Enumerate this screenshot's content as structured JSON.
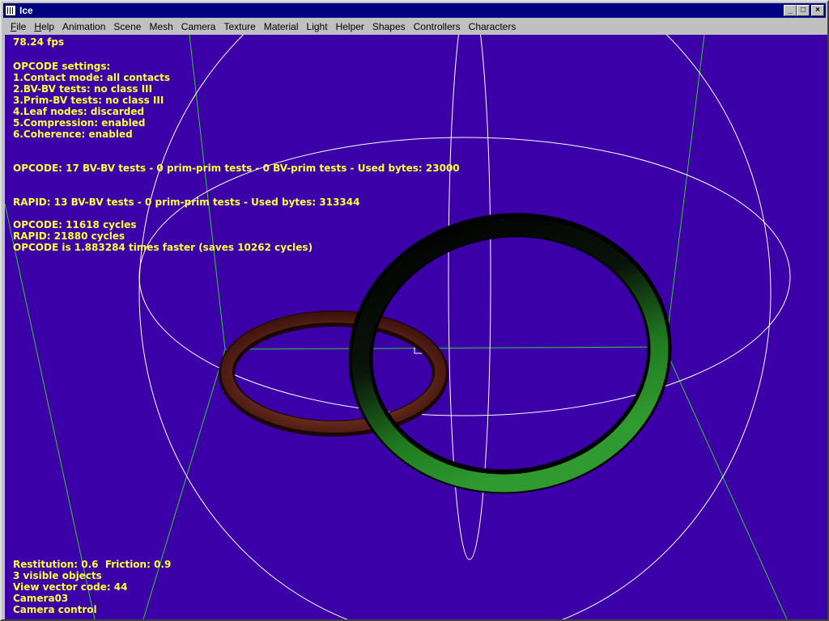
{
  "window": {
    "title": "Ice",
    "minimize_glyph": "_",
    "maximize_glyph": "□",
    "close_glyph": "×"
  },
  "menu": [
    "File",
    "Help",
    "Animation",
    "Scene",
    "Mesh",
    "Camera",
    "Texture",
    "Material",
    "Light",
    "Helper",
    "Shapes",
    "Controllers",
    "Characters"
  ],
  "hud": {
    "fps": "78.24 fps",
    "settings_title": "OPCODE settings:",
    "settings": [
      "1.Contact mode: all contacts",
      "2.BV-BV tests: no class III",
      "3.Prim-BV tests: no class III",
      "4.Leaf nodes: discarded",
      "5.Compression: enabled",
      "6.Coherence: enabled"
    ],
    "opcode_stats": "OPCODE: 17 BV-BV tests - 0 prim-prim tests - 0 BV-prim tests - Used bytes: 23000",
    "rapid_stats": "RAPID: 13 BV-BV tests - 0 prim-prim tests - Used bytes: 313344",
    "opcode_cycles": "OPCODE: 11618 cycles",
    "rapid_cycles": "RAPID: 21880 cycles",
    "comparison": "OPCODE is 1.883284 times faster (saves 10262 cycles)",
    "bottom": [
      "Restitution: 0.6  Friction: 0.9",
      "3 visible objects",
      "View vector code: 44",
      "Camera03",
      "Camera control"
    ]
  },
  "colors": {
    "viewport_bg": "#3b00a8",
    "hud_text": "#ffff3a",
    "titlebar": "#000080",
    "wire_white": "#ffffff",
    "wire_green": "#33cc33",
    "torus_red": "#8a3a2a",
    "torus_green": "#2a8a2a"
  }
}
